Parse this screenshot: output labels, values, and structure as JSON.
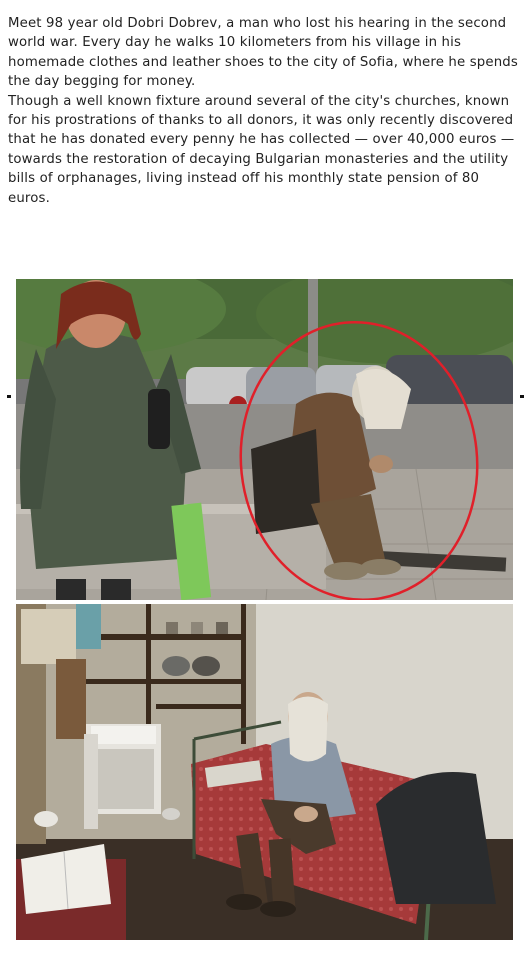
{
  "caption": {
    "paragraph_1": "Meet 98 year old Dobri Dobrev, a man who lost his hearing in the second world war. Every day he walks 10 kilometers from his village in his homemade clothes and leather shoes to the city of Sofia, where he spends the day begging for money.",
    "paragraph_2": "Though a well known fixture around several of the city's churches, known for his prostrations of thanks to all donors, it was only recently discovered that he has donated every penny he has collected — over 40,000 euros — towards the restoration of decaying Bulgarian monasteries and the utility bills of orphanages, living instead off his monthly state pension of 80 euros."
  },
  "photos": [
    {
      "subject": "street-scene-man-sitting-on-curb",
      "highlight_color": "#e0202a"
    },
    {
      "subject": "man-sitting-on-bed-in-small-room"
    }
  ],
  "colors": {
    "text": "#222222",
    "highlight_circle": "#e0202a"
  }
}
